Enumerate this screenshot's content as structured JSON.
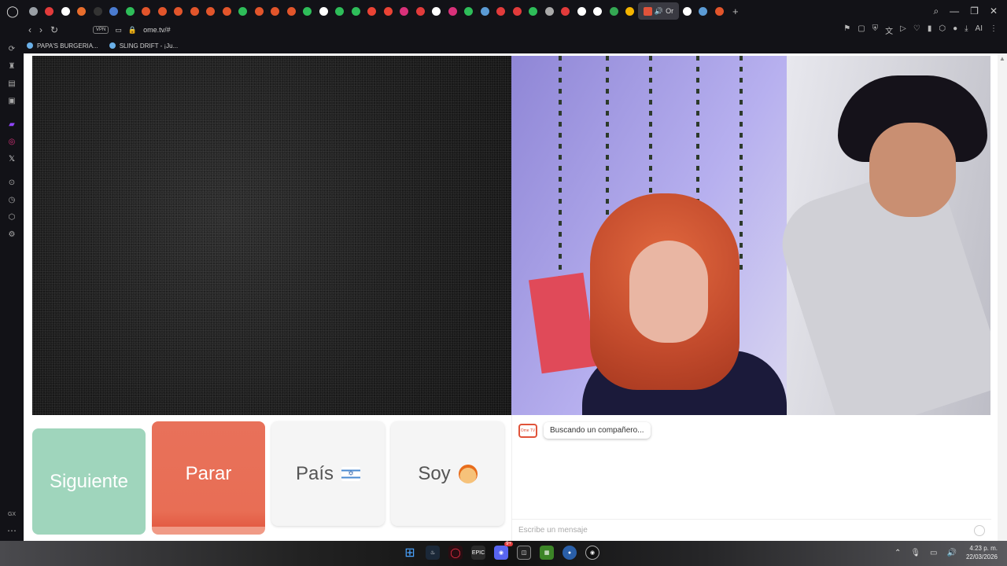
{
  "browser": {
    "url": "ome.tv/#",
    "vpn_label": "VPN",
    "active_tab_label": "Or",
    "bookmarks": [
      {
        "label": "PAPA'S BURGERIA..."
      },
      {
        "label": "SLING DRIFT - ¡Ju..."
      }
    ],
    "ai_label": "AI",
    "sidebar_gx_label": "GX",
    "tab_colors": [
      "#9aa0a6",
      "#e23b3b",
      "#ffffff",
      "#e86d2c",
      "#333",
      "#4a7bd0",
      "#2ebd59",
      "#e2552b",
      "#e2552b",
      "#e2552b",
      "#e2552b",
      "#e2552b",
      "#e2552b",
      "#2ebd59",
      "#e2552b",
      "#e2552b",
      "#e2552b",
      "#2ebd59",
      "#ffffff",
      "#2ebd59",
      "#2ebd59",
      "#ea4335",
      "#ea4335",
      "#d9317a",
      "#e23b3b",
      "#ffffff",
      "#d9317a",
      "#2ebd59",
      "#5b9bd5",
      "#e23b3b",
      "#e23b3b",
      "#2ebd59",
      "#aaaaaa",
      "#e23b3b",
      "#ffffff",
      "#ffffff",
      "#34a853",
      "#f4b400",
      "#ffffff",
      "#5b9bd5",
      "#e2552b"
    ]
  },
  "ome": {
    "buttons": {
      "next": "Siguiente",
      "stop": "Parar",
      "country": "País",
      "gender": "Soy"
    },
    "chat": {
      "tv_icon_label": "Ome TV",
      "status_message": "Buscando un compañero...",
      "input_placeholder": "Escribe un mensaje"
    }
  },
  "taskbar": {
    "time": "4:23 p. m.",
    "date": "22/03/2026",
    "discord_badge": "9+",
    "epic_label": "EPIC"
  },
  "colors": {
    "next_button": "#9fd5bc",
    "stop_button": "#e8715a",
    "accent": "#e0533a"
  }
}
